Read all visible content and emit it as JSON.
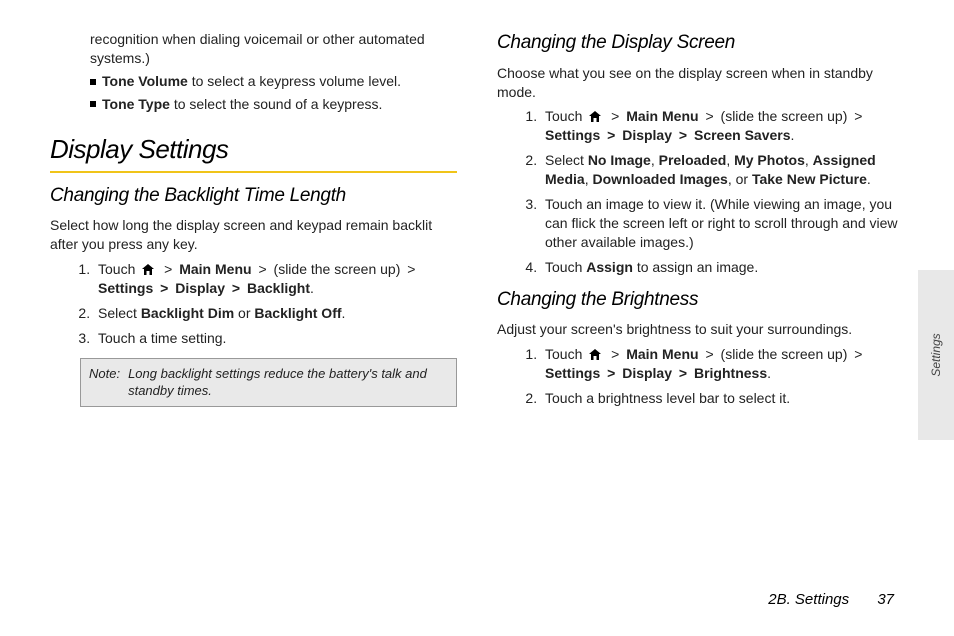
{
  "left": {
    "continuation": "recognition when dialing voicemail or other automated systems.)",
    "bullets": {
      "tone_volume_label": "Tone Volume",
      "tone_volume_rest": " to select a keypress volume level.",
      "tone_type_label": "Tone Type",
      "tone_type_rest": " to select the sound of a keypress."
    },
    "h1": "Display Settings",
    "h2": "Changing the Backlight Time Length",
    "intro": "Select how long the display screen and keypad remain backlit after you press any key.",
    "steps": {
      "s1_pre": "Touch ",
      "s1_main_menu": "Main Menu",
      "s1_mid": " (slide the screen up) ",
      "s1_settings": "Settings",
      "s1_display": "Display",
      "s1_backlight": "Backlight",
      "s2_sel": "Select ",
      "s2_dim": "Backlight Dim",
      "s2_or": " or ",
      "s2_off": "Backlight Off",
      "s3": "Touch a time setting."
    },
    "note_label": "Note:",
    "note_text": "Long backlight settings reduce the battery's talk and standby times."
  },
  "right": {
    "h2a": "Changing the Display Screen",
    "intro_a": "Choose what you see on the display screen when in standby mode.",
    "a_steps": {
      "s1_pre": "Touch ",
      "s1_main_menu": "Main Menu",
      "s1_mid": " (slide the screen up) ",
      "s1_settings": "Settings",
      "s1_display": "Display",
      "s1_screen": "Screen Savers",
      "s2_sel": "Select ",
      "s2_noimg": "No Image",
      "s2_pre": "Preloaded",
      "s2_my": "My Photos",
      "s2_ass": "Assigned Media",
      "s2_dl": "Downloaded Images",
      "s2_or": ", or ",
      "s2_take": "Take New Picture",
      "s3": "Touch an image to view it. (While viewing an image, you can flick the screen left or right to scroll through and view other available images.)",
      "s4_pre": "Touch ",
      "s4_assign": "Assign",
      "s4_post": " to assign an image."
    },
    "h2b": "Changing the Brightness",
    "intro_b": "Adjust your screen's brightness to suit your surroundings.",
    "b_steps": {
      "s1_pre": "Touch ",
      "s1_main_menu": "Main Menu",
      "s1_mid": " (slide the screen up) ",
      "s1_settings": "Settings",
      "s1_display": "Display",
      "s1_bright": "Brightness",
      "s2": "Touch a brightness level bar to select it."
    }
  },
  "side_tab": "Settings",
  "footer_section": "2B. Settings",
  "footer_page": "37",
  "gt": ">"
}
